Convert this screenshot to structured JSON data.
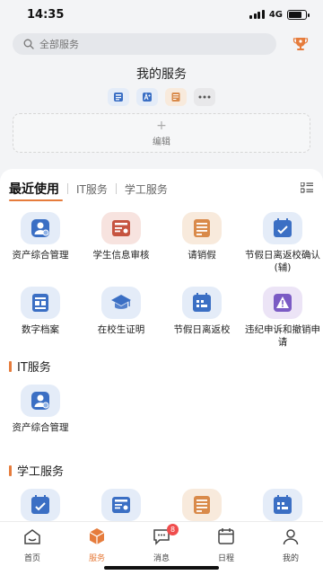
{
  "status": {
    "time": "14:35",
    "network": "4G",
    "battery_level": 0.8
  },
  "search": {
    "placeholder": "全部服务"
  },
  "my_services": {
    "title": "我的服务",
    "shortcut_icons": [
      "id-card-icon",
      "a-plus-icon",
      "leave-note-icon",
      "more-icon"
    ],
    "edit_label": "编辑"
  },
  "tabs": [
    {
      "label": "最近使用"
    },
    {
      "label": "IT服务"
    },
    {
      "label": "学工服务"
    }
  ],
  "recent": [
    {
      "label": "资产综合管理",
      "icon": "asset-user-icon",
      "bg": "#e4ecf8",
      "color": "#3b6fc4"
    },
    {
      "label": "学生信息审核",
      "icon": "student-card-icon",
      "bg": "#f7e3df",
      "color": "#c65440"
    },
    {
      "label": "请销假",
      "icon": "leave-form-icon",
      "bg": "#f8eadc",
      "color": "#d98a4a"
    },
    {
      "label": "节假日离返校确认(辅)",
      "icon": "holiday-confirm-icon",
      "bg": "#e4ecf8",
      "color": "#3b6fc4"
    },
    {
      "label": "数字档案",
      "icon": "archive-icon",
      "bg": "#e4ecf8",
      "color": "#3b6fc4"
    },
    {
      "label": "在校生证明",
      "icon": "graduation-cap-icon",
      "bg": "#e4ecf8",
      "color": "#3b6fc4"
    },
    {
      "label": "节假日离返校",
      "icon": "holiday-return-icon",
      "bg": "#e4ecf8",
      "color": "#3b6fc4"
    },
    {
      "label": "违纪申诉和撤销申请",
      "icon": "appeal-warning-icon",
      "bg": "#ece4f6",
      "color": "#7b5bc4"
    }
  ],
  "it_section": {
    "title": "IT服务",
    "items": [
      {
        "label": "资产综合管理",
        "icon": "asset-user-icon",
        "bg": "#e4ecf8",
        "color": "#3b6fc4"
      }
    ]
  },
  "xg_section": {
    "title": "学工服务",
    "items": [
      {
        "icon": "holiday-confirm-icon",
        "bg": "#e4ecf8",
        "color": "#3b6fc4"
      },
      {
        "icon": "student-card-icon",
        "bg": "#e4ecf8",
        "color": "#3b6fc4"
      },
      {
        "icon": "leave-form-icon",
        "bg": "#f8eadc",
        "color": "#d98a4a"
      },
      {
        "icon": "holiday-return-icon",
        "bg": "#e4ecf8",
        "color": "#3b6fc4"
      }
    ]
  },
  "nav": [
    {
      "label": "首页",
      "icon": "home-icon"
    },
    {
      "label": "服务",
      "icon": "service-cube-icon",
      "active": true
    },
    {
      "label": "消息",
      "icon": "message-icon",
      "badge": "8"
    },
    {
      "label": "日程",
      "icon": "calendar-icon"
    },
    {
      "label": "我的",
      "icon": "profile-icon"
    }
  ],
  "colors": {
    "accent": "#e67c3c",
    "badge": "#f04d4d"
  }
}
